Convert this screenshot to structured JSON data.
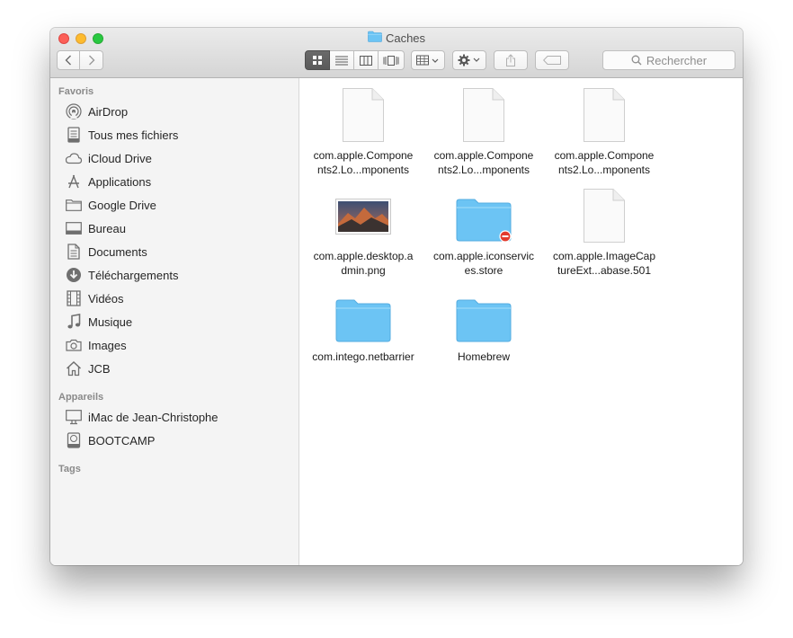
{
  "window": {
    "title": "Caches"
  },
  "toolbar": {
    "search_placeholder": "Rechercher",
    "view_active": "icons"
  },
  "sidebar": {
    "favorites_title": "Favoris",
    "favorites": [
      {
        "label": "AirDrop",
        "icon": "airdrop-icon"
      },
      {
        "label": "Tous mes fichiers",
        "icon": "all-files-icon"
      },
      {
        "label": "iCloud Drive",
        "icon": "cloud-icon"
      },
      {
        "label": "Applications",
        "icon": "applications-icon"
      },
      {
        "label": "Google Drive",
        "icon": "folder-icon"
      },
      {
        "label": "Bureau",
        "icon": "desktop-icon"
      },
      {
        "label": "Documents",
        "icon": "documents-icon"
      },
      {
        "label": "Téléchargements",
        "icon": "downloads-icon"
      },
      {
        "label": "Vidéos",
        "icon": "movies-icon"
      },
      {
        "label": "Musique",
        "icon": "music-icon"
      },
      {
        "label": "Images",
        "icon": "camera-icon"
      },
      {
        "label": "JCB",
        "icon": "home-icon"
      }
    ],
    "devices_title": "Appareils",
    "devices": [
      {
        "label": "iMac de Jean-Christophe",
        "icon": "imac-icon"
      },
      {
        "label": "BOOTCAMP",
        "icon": "disk-icon"
      }
    ],
    "tags_title": "Tags"
  },
  "files": [
    {
      "name": "com.apple.Components2.Lo...mponents",
      "type": "document"
    },
    {
      "name": "com.apple.Components2.Lo...mponents",
      "type": "document"
    },
    {
      "name": "com.apple.Components2.Lo...mponents",
      "type": "document"
    },
    {
      "name": "com.apple.desktop.admin.png",
      "type": "image"
    },
    {
      "name": "com.apple.iconservices.store",
      "type": "restricted-folder"
    },
    {
      "name": "com.apple.ImageCaptureExt...abase.501",
      "type": "document"
    },
    {
      "name": "com.intego.netbarrier",
      "type": "folder"
    },
    {
      "name": "Homebrew",
      "type": "folder"
    }
  ],
  "colors": {
    "folder": "#6cc4f4",
    "close": "#fc5f57",
    "minimize": "#fdbb2e",
    "maximize": "#28c840"
  }
}
